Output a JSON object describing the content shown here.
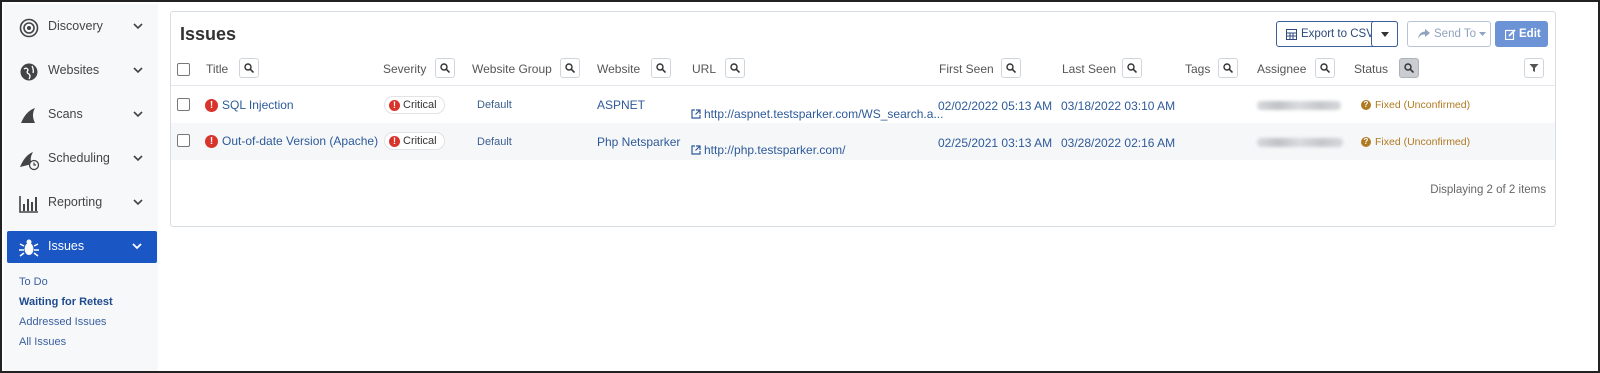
{
  "sidebar": {
    "items": [
      {
        "label": "Discovery",
        "icon": "target-icon"
      },
      {
        "label": "Websites",
        "icon": "globe-icon"
      },
      {
        "label": "Scans",
        "icon": "shark-fin-icon"
      },
      {
        "label": "Scheduling",
        "icon": "shark-fin-clock-icon"
      },
      {
        "label": "Reporting",
        "icon": "bar-chart-icon"
      },
      {
        "label": "Issues",
        "icon": "bug-icon"
      }
    ],
    "subitems": [
      "To Do",
      "Waiting for Retest",
      "Addressed Issues",
      "All Issues"
    ]
  },
  "main": {
    "title": "Issues",
    "toolbar": {
      "export_label": "Export to CSV",
      "send_label": "Send To",
      "edit_label": "Edit"
    },
    "columns": [
      "Title",
      "Severity",
      "Website Group",
      "Website",
      "URL",
      "First Seen",
      "Last Seen",
      "Tags",
      "Assignee",
      "Status"
    ],
    "rows": [
      {
        "title": "SQL Injection",
        "severity": "Critical",
        "group": "Default",
        "website": "ASPNET",
        "url": "http://aspnet.testsparker.com/WS_search.a...",
        "first_seen": "02/02/2022 05:13 AM",
        "last_seen": "03/18/2022 03:10 AM",
        "status": "Fixed (Unconfirmed)"
      },
      {
        "title": "Out-of-date Version (Apache)",
        "severity": "Critical",
        "group": "Default",
        "website": "Php Netsparker",
        "url": "http://php.testsparker.com/",
        "first_seen": "02/25/2021 03:13 AM",
        "last_seen": "03/28/2022 02:16 AM",
        "status": "Fixed (Unconfirmed)"
      }
    ],
    "footer": "Displaying 2 of 2 items"
  },
  "colors": {
    "accent": "#1a56c4",
    "link": "#2d5a9a",
    "critical": "#d9342b",
    "status_fixed": "#b07a22",
    "edit_button": "#6c93d6"
  }
}
